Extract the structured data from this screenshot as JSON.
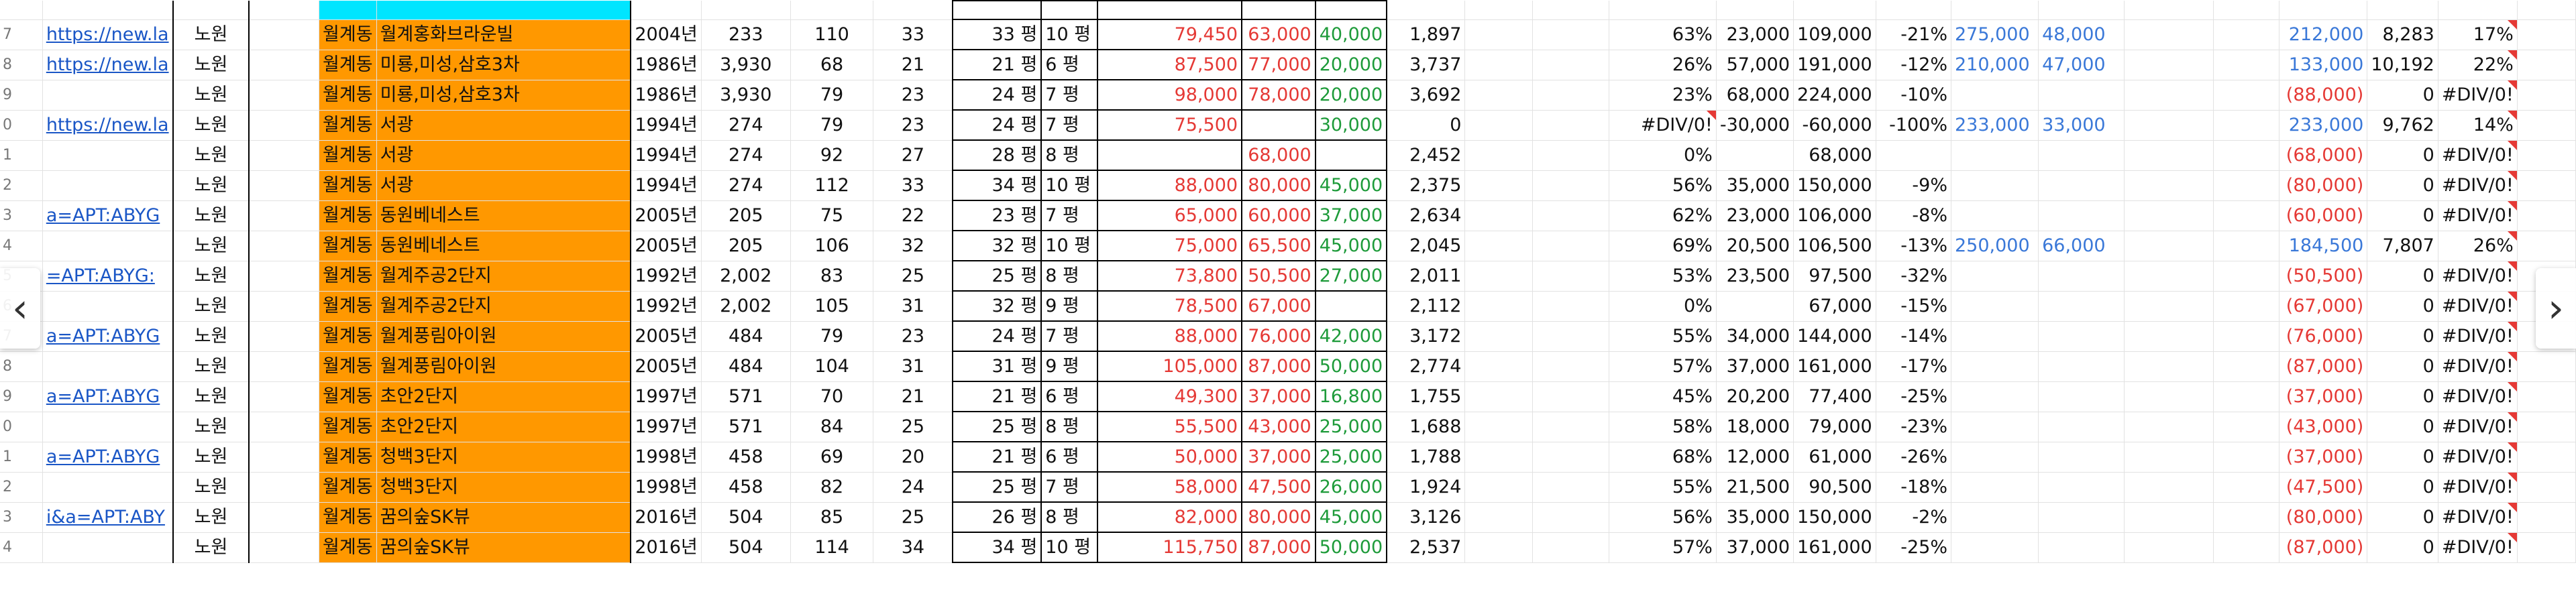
{
  "colors": {
    "accent_orange": "#ff9800",
    "negative_red": "#e53935",
    "positive_green": "#1e9b3a",
    "link_blue": "#3a78d8"
  },
  "icons": {
    "prev": "chevron-left-icon",
    "next": "chevron-right-icon"
  },
  "nav": {
    "prev_glyph": "‹",
    "next_glyph": "›"
  },
  "rows": [
    {
      "rn": "7",
      "link": "https://new.la",
      "gu": "노원",
      "dong": "월계동",
      "apt": "월계홍화브라운빌",
      "year": "2004년",
      "hh": "233",
      "sz": "110",
      "n1": "33",
      "n2": "33 평",
      "n3": "10 평",
      "p1": "79,450",
      "p2": "63,000",
      "p3": "40,000",
      "p4": "1,897",
      "rate": "63%",
      "d1": "23,000",
      "d2": "109,000",
      "chg": "-21%",
      "b1": "275,000",
      "b2": "48,000",
      "x1": "212,000",
      "x2": "8,283",
      "x3": "17%"
    },
    {
      "rn": "8",
      "link": "https://new.la",
      "gu": "노원",
      "dong": "월계동",
      "apt": "미룡,미성,삼호3차",
      "year": "1986년",
      "hh": "3,930",
      "sz": "68",
      "n1": "21",
      "n2": "21 평",
      "n3": "6 평",
      "p1": "87,500",
      "p2": "77,000",
      "p3": "20,000",
      "p4": "3,737",
      "rate": "26%",
      "d1": "57,000",
      "d2": "191,000",
      "chg": "-12%",
      "b1": "210,000",
      "b2": "47,000",
      "x1": "133,000",
      "x2": "10,192",
      "x3": "22%"
    },
    {
      "rn": "9",
      "link": "",
      "gu": "노원",
      "dong": "월계동",
      "apt": "미룡,미성,삼호3차",
      "year": "1986년",
      "hh": "3,930",
      "sz": "79",
      "n1": "23",
      "n2": "24 평",
      "n3": "7 평",
      "p1": "98,000",
      "p2": "78,000",
      "p3": "20,000",
      "p4": "3,692",
      "rate": "23%",
      "d1": "68,000",
      "d2": "224,000",
      "chg": "-10%",
      "b1": "",
      "b2": "",
      "x1": "(88,000)",
      "x2": "0",
      "x3": "#DIV/0!"
    },
    {
      "rn": "0",
      "link": "https://new.la",
      "gu": "노원",
      "dong": "월계동",
      "apt": "서광",
      "year": "1994년",
      "hh": "274",
      "sz": "79",
      "n1": "23",
      "n2": "24 평",
      "n3": "7 평",
      "p1": "75,500",
      "p2": "",
      "p3": "30,000",
      "p4": "0",
      "rate": "#DIV/0!",
      "d1": "-30,000",
      "d2": "-60,000",
      "chg": "-100%",
      "b1": "233,000",
      "b2": "33,000",
      "x1": "233,000",
      "x2": "9,762",
      "x3": "14%"
    },
    {
      "rn": "1",
      "link": "",
      "gu": "노원",
      "dong": "월계동",
      "apt": "서광",
      "year": "1994년",
      "hh": "274",
      "sz": "92",
      "n1": "27",
      "n2": "28 평",
      "n3": "8 평",
      "p1": "",
      "p2": "68,000",
      "p3": "",
      "p4": "2,452",
      "rate": "0%",
      "d1": "",
      "d2": "68,000",
      "chg": "",
      "b1": "",
      "b2": "",
      "x1": "(68,000)",
      "x2": "0",
      "x3": "#DIV/0!"
    },
    {
      "rn": "2",
      "link": "",
      "gu": "노원",
      "dong": "월계동",
      "apt": "서광",
      "year": "1994년",
      "hh": "274",
      "sz": "112",
      "n1": "33",
      "n2": "34 평",
      "n3": "10 평",
      "p1": "88,000",
      "p2": "80,000",
      "p3": "45,000",
      "p4": "2,375",
      "rate": "56%",
      "d1": "35,000",
      "d2": "150,000",
      "chg": "-9%",
      "b1": "",
      "b2": "",
      "x1": "(80,000)",
      "x2": "0",
      "x3": "#DIV/0!"
    },
    {
      "rn": "3",
      "link": "a=APT:ABYG",
      "gu": "노원",
      "dong": "월계동",
      "apt": "동원베네스트",
      "year": "2005년",
      "hh": "205",
      "sz": "75",
      "n1": "22",
      "n2": "23 평",
      "n3": "7 평",
      "p1": "65,000",
      "p2": "60,000",
      "p3": "37,000",
      "p4": "2,634",
      "rate": "62%",
      "d1": "23,000",
      "d2": "106,000",
      "chg": "-8%",
      "b1": "",
      "b2": "",
      "x1": "(60,000)",
      "x2": "0",
      "x3": "#DIV/0!"
    },
    {
      "rn": "4",
      "link": "",
      "gu": "노원",
      "dong": "월계동",
      "apt": "동원베네스트",
      "year": "2005년",
      "hh": "205",
      "sz": "106",
      "n1": "32",
      "n2": "32 평",
      "n3": "10 평",
      "p1": "75,000",
      "p2": "65,500",
      "p3": "45,000",
      "p4": "2,045",
      "rate": "69%",
      "d1": "20,500",
      "d2": "106,500",
      "chg": "-13%",
      "b1": "250,000",
      "b2": "66,000",
      "x1": "184,500",
      "x2": "7,807",
      "x3": "26%"
    },
    {
      "rn": "5",
      "link": "=APT:ABYG:",
      "gu": "노원",
      "dong": "월계동",
      "apt": "월계주공2단지",
      "year": "1992년",
      "hh": "2,002",
      "sz": "83",
      "n1": "25",
      "n2": "25 평",
      "n3": "8 평",
      "p1": "73,800",
      "p2": "50,500",
      "p3": "27,000",
      "p4": "2,011",
      "rate": "53%",
      "d1": "23,500",
      "d2": "97,500",
      "chg": "-32%",
      "b1": "",
      "b2": "",
      "x1": "(50,500)",
      "x2": "0",
      "x3": "#DIV/0!"
    },
    {
      "rn": "6",
      "link": "",
      "gu": "노원",
      "dong": "월계동",
      "apt": "월계주공2단지",
      "year": "1992년",
      "hh": "2,002",
      "sz": "105",
      "n1": "31",
      "n2": "32 평",
      "n3": "9 평",
      "p1": "78,500",
      "p2": "67,000",
      "p3": "",
      "p4": "2,112",
      "rate": "0%",
      "d1": "",
      "d2": "67,000",
      "chg": "-15%",
      "b1": "",
      "b2": "",
      "x1": "(67,000)",
      "x2": "0",
      "x3": "#DIV/0!"
    },
    {
      "rn": "7",
      "link": "a=APT:ABYG",
      "gu": "노원",
      "dong": "월계동",
      "apt": "월계풍림아이원",
      "year": "2005년",
      "hh": "484",
      "sz": "79",
      "n1": "23",
      "n2": "24 평",
      "n3": "7 평",
      "p1": "88,000",
      "p2": "76,000",
      "p3": "42,000",
      "p4": "3,172",
      "rate": "55%",
      "d1": "34,000",
      "d2": "144,000",
      "chg": "-14%",
      "b1": "",
      "b2": "",
      "x1": "(76,000)",
      "x2": "0",
      "x3": "#DIV/0!"
    },
    {
      "rn": "8",
      "link": "",
      "gu": "노원",
      "dong": "월계동",
      "apt": "월계풍림아이원",
      "year": "2005년",
      "hh": "484",
      "sz": "104",
      "n1": "31",
      "n2": "31 평",
      "n3": "9 평",
      "p1": "105,000",
      "p2": "87,000",
      "p3": "50,000",
      "p4": "2,774",
      "rate": "57%",
      "d1": "37,000",
      "d2": "161,000",
      "chg": "-17%",
      "b1": "",
      "b2": "",
      "x1": "(87,000)",
      "x2": "0",
      "x3": "#DIV/0!"
    },
    {
      "rn": "9",
      "link": "a=APT:ABYG",
      "gu": "노원",
      "dong": "월계동",
      "apt": "초안2단지",
      "year": "1997년",
      "hh": "571",
      "sz": "70",
      "n1": "21",
      "n2": "21 평",
      "n3": "6 평",
      "p1": "49,300",
      "p2": "37,000",
      "p3": "16,800",
      "p4": "1,755",
      "rate": "45%",
      "d1": "20,200",
      "d2": "77,400",
      "chg": "-25%",
      "b1": "",
      "b2": "",
      "x1": "(37,000)",
      "x2": "0",
      "x3": "#DIV/0!"
    },
    {
      "rn": "0",
      "link": "",
      "gu": "노원",
      "dong": "월계동",
      "apt": "초안2단지",
      "year": "1997년",
      "hh": "571",
      "sz": "84",
      "n1": "25",
      "n2": "25 평",
      "n3": "8 평",
      "p1": "55,500",
      "p2": "43,000",
      "p3": "25,000",
      "p4": "1,688",
      "rate": "58%",
      "d1": "18,000",
      "d2": "79,000",
      "chg": "-23%",
      "b1": "",
      "b2": "",
      "x1": "(43,000)",
      "x2": "0",
      "x3": "#DIV/0!"
    },
    {
      "rn": "1",
      "link": "a=APT:ABYG",
      "gu": "노원",
      "dong": "월계동",
      "apt": "청백3단지",
      "year": "1998년",
      "hh": "458",
      "sz": "69",
      "n1": "20",
      "n2": "21 평",
      "n3": "6 평",
      "p1": "50,000",
      "p2": "37,000",
      "p3": "25,000",
      "p4": "1,788",
      "rate": "68%",
      "d1": "12,000",
      "d2": "61,000",
      "chg": "-26%",
      "b1": "",
      "b2": "",
      "x1": "(37,000)",
      "x2": "0",
      "x3": "#DIV/0!"
    },
    {
      "rn": "2",
      "link": "",
      "gu": "노원",
      "dong": "월계동",
      "apt": "청백3단지",
      "year": "1998년",
      "hh": "458",
      "sz": "82",
      "n1": "24",
      "n2": "25 평",
      "n3": "7 평",
      "p1": "58,000",
      "p2": "47,500",
      "p3": "26,000",
      "p4": "1,924",
      "rate": "55%",
      "d1": "21,500",
      "d2": "90,500",
      "chg": "-18%",
      "b1": "",
      "b2": "",
      "x1": "(47,500)",
      "x2": "0",
      "x3": "#DIV/0!"
    },
    {
      "rn": "3",
      "link": "i&a=APT:ABY",
      "gu": "노원",
      "dong": "월계동",
      "apt": "꿈의숲SK뷰",
      "year": "2016년",
      "hh": "504",
      "sz": "85",
      "n1": "25",
      "n2": "26 평",
      "n3": "8 평",
      "p1": "82,000",
      "p2": "80,000",
      "p3": "45,000",
      "p4": "3,126",
      "rate": "56%",
      "d1": "35,000",
      "d2": "150,000",
      "chg": "-2%",
      "b1": "",
      "b2": "",
      "x1": "(80,000)",
      "x2": "0",
      "x3": "#DIV/0!"
    },
    {
      "rn": "4",
      "link": "",
      "gu": "노원",
      "dong": "월계동",
      "apt": "꿈의숲SK뷰",
      "year": "2016년",
      "hh": "504",
      "sz": "114",
      "n1": "34",
      "n2": "34 평",
      "n3": "10 평",
      "p1": "115,750",
      "p2": "87,000",
      "p3": "50,000",
      "p4": "2,537",
      "rate": "57%",
      "d1": "37,000",
      "d2": "161,000",
      "chg": "-25%",
      "b1": "",
      "b2": "",
      "x1": "(87,000)",
      "x2": "0",
      "x3": "#DIV/0!"
    }
  ]
}
